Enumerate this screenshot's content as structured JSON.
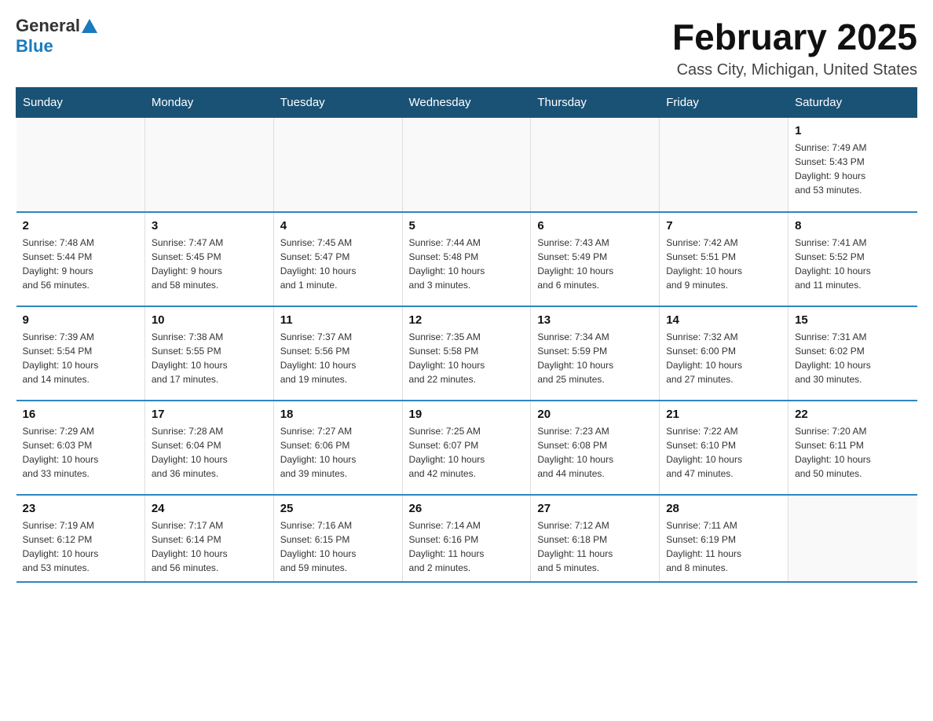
{
  "logo": {
    "general": "General",
    "blue": "Blue"
  },
  "title": "February 2025",
  "location": "Cass City, Michigan, United States",
  "days_of_week": [
    "Sunday",
    "Monday",
    "Tuesday",
    "Wednesday",
    "Thursday",
    "Friday",
    "Saturday"
  ],
  "weeks": [
    [
      {
        "day": "",
        "info": ""
      },
      {
        "day": "",
        "info": ""
      },
      {
        "day": "",
        "info": ""
      },
      {
        "day": "",
        "info": ""
      },
      {
        "day": "",
        "info": ""
      },
      {
        "day": "",
        "info": ""
      },
      {
        "day": "1",
        "info": "Sunrise: 7:49 AM\nSunset: 5:43 PM\nDaylight: 9 hours\nand 53 minutes."
      }
    ],
    [
      {
        "day": "2",
        "info": "Sunrise: 7:48 AM\nSunset: 5:44 PM\nDaylight: 9 hours\nand 56 minutes."
      },
      {
        "day": "3",
        "info": "Sunrise: 7:47 AM\nSunset: 5:45 PM\nDaylight: 9 hours\nand 58 minutes."
      },
      {
        "day": "4",
        "info": "Sunrise: 7:45 AM\nSunset: 5:47 PM\nDaylight: 10 hours\nand 1 minute."
      },
      {
        "day": "5",
        "info": "Sunrise: 7:44 AM\nSunset: 5:48 PM\nDaylight: 10 hours\nand 3 minutes."
      },
      {
        "day": "6",
        "info": "Sunrise: 7:43 AM\nSunset: 5:49 PM\nDaylight: 10 hours\nand 6 minutes."
      },
      {
        "day": "7",
        "info": "Sunrise: 7:42 AM\nSunset: 5:51 PM\nDaylight: 10 hours\nand 9 minutes."
      },
      {
        "day": "8",
        "info": "Sunrise: 7:41 AM\nSunset: 5:52 PM\nDaylight: 10 hours\nand 11 minutes."
      }
    ],
    [
      {
        "day": "9",
        "info": "Sunrise: 7:39 AM\nSunset: 5:54 PM\nDaylight: 10 hours\nand 14 minutes."
      },
      {
        "day": "10",
        "info": "Sunrise: 7:38 AM\nSunset: 5:55 PM\nDaylight: 10 hours\nand 17 minutes."
      },
      {
        "day": "11",
        "info": "Sunrise: 7:37 AM\nSunset: 5:56 PM\nDaylight: 10 hours\nand 19 minutes."
      },
      {
        "day": "12",
        "info": "Sunrise: 7:35 AM\nSunset: 5:58 PM\nDaylight: 10 hours\nand 22 minutes."
      },
      {
        "day": "13",
        "info": "Sunrise: 7:34 AM\nSunset: 5:59 PM\nDaylight: 10 hours\nand 25 minutes."
      },
      {
        "day": "14",
        "info": "Sunrise: 7:32 AM\nSunset: 6:00 PM\nDaylight: 10 hours\nand 27 minutes."
      },
      {
        "day": "15",
        "info": "Sunrise: 7:31 AM\nSunset: 6:02 PM\nDaylight: 10 hours\nand 30 minutes."
      }
    ],
    [
      {
        "day": "16",
        "info": "Sunrise: 7:29 AM\nSunset: 6:03 PM\nDaylight: 10 hours\nand 33 minutes."
      },
      {
        "day": "17",
        "info": "Sunrise: 7:28 AM\nSunset: 6:04 PM\nDaylight: 10 hours\nand 36 minutes."
      },
      {
        "day": "18",
        "info": "Sunrise: 7:27 AM\nSunset: 6:06 PM\nDaylight: 10 hours\nand 39 minutes."
      },
      {
        "day": "19",
        "info": "Sunrise: 7:25 AM\nSunset: 6:07 PM\nDaylight: 10 hours\nand 42 minutes."
      },
      {
        "day": "20",
        "info": "Sunrise: 7:23 AM\nSunset: 6:08 PM\nDaylight: 10 hours\nand 44 minutes."
      },
      {
        "day": "21",
        "info": "Sunrise: 7:22 AM\nSunset: 6:10 PM\nDaylight: 10 hours\nand 47 minutes."
      },
      {
        "day": "22",
        "info": "Sunrise: 7:20 AM\nSunset: 6:11 PM\nDaylight: 10 hours\nand 50 minutes."
      }
    ],
    [
      {
        "day": "23",
        "info": "Sunrise: 7:19 AM\nSunset: 6:12 PM\nDaylight: 10 hours\nand 53 minutes."
      },
      {
        "day": "24",
        "info": "Sunrise: 7:17 AM\nSunset: 6:14 PM\nDaylight: 10 hours\nand 56 minutes."
      },
      {
        "day": "25",
        "info": "Sunrise: 7:16 AM\nSunset: 6:15 PM\nDaylight: 10 hours\nand 59 minutes."
      },
      {
        "day": "26",
        "info": "Sunrise: 7:14 AM\nSunset: 6:16 PM\nDaylight: 11 hours\nand 2 minutes."
      },
      {
        "day": "27",
        "info": "Sunrise: 7:12 AM\nSunset: 6:18 PM\nDaylight: 11 hours\nand 5 minutes."
      },
      {
        "day": "28",
        "info": "Sunrise: 7:11 AM\nSunset: 6:19 PM\nDaylight: 11 hours\nand 8 minutes."
      },
      {
        "day": "",
        "info": ""
      }
    ]
  ]
}
